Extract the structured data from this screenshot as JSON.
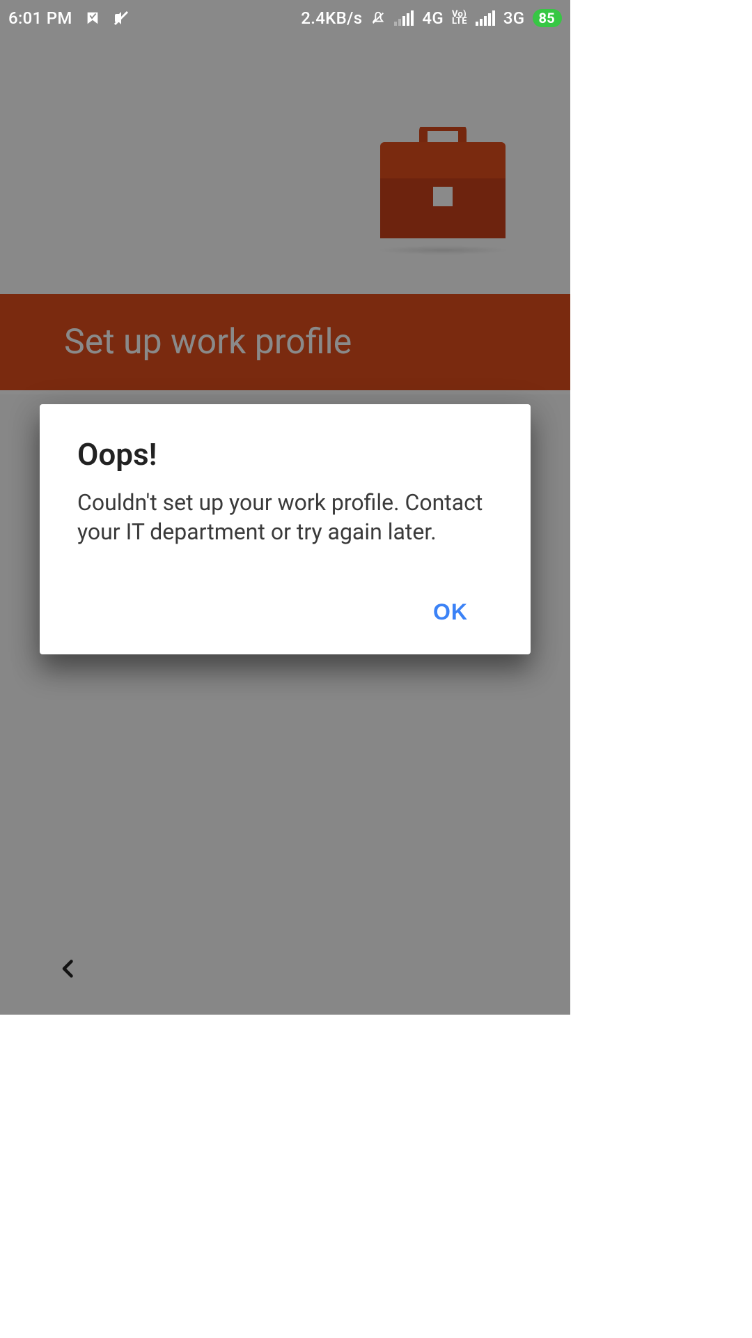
{
  "status_bar": {
    "time": "6:01 PM",
    "data_rate": "2.4KB/s",
    "network1": "4G",
    "network2": "3G",
    "volte_top": "Vo)",
    "volte_bottom": "LTE",
    "battery": "85"
  },
  "page": {
    "title": "Set up work profile"
  },
  "dialog": {
    "title": "Oops!",
    "message": "Couldn't set up your work profile. Contact your IT department or try again later.",
    "ok_label": "OK"
  },
  "colors": {
    "accent": "#e14f1d",
    "ok_button": "#3b82f6",
    "battery_pill": "#37c744"
  }
}
